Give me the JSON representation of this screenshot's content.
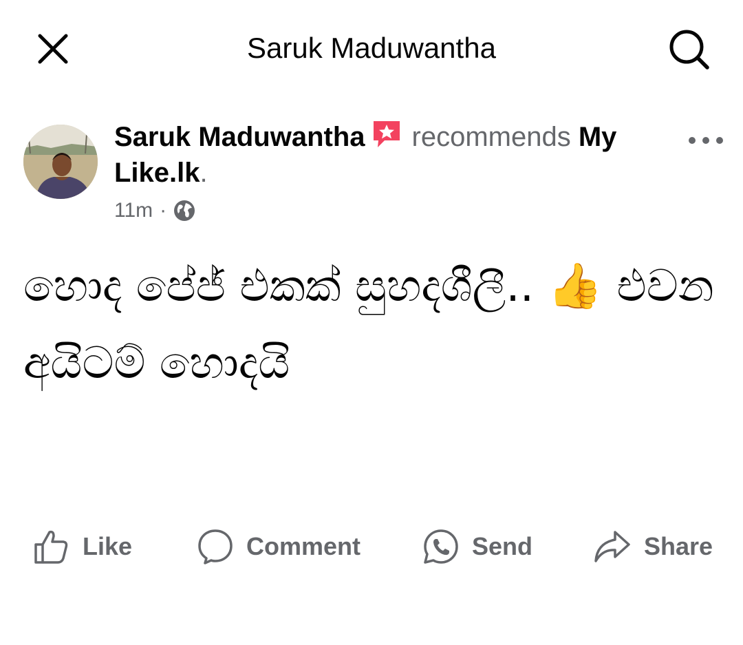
{
  "topbar": {
    "title": "Saruk Maduwantha",
    "close_icon": "close-icon",
    "search_icon": "search-icon"
  },
  "post": {
    "author": "Saruk Maduwantha",
    "badge_icon": "recommendation-star-icon",
    "verb": "recommends",
    "page": "My Like.lk",
    "punctuation": ".",
    "time": "11m",
    "separator": "·",
    "audience_icon": "globe-icon",
    "more_icon": "more-options-icon",
    "text": "හොද පේජ් එකක් සුහදශීලී.. 👍 එවන අයිටම් හොදයි"
  },
  "actions": {
    "like": "Like",
    "comment": "Comment",
    "send": "Send",
    "share": "Share"
  },
  "colors": {
    "text_primary": "#050505",
    "text_secondary": "#65676b",
    "badge": "#f3425f"
  }
}
